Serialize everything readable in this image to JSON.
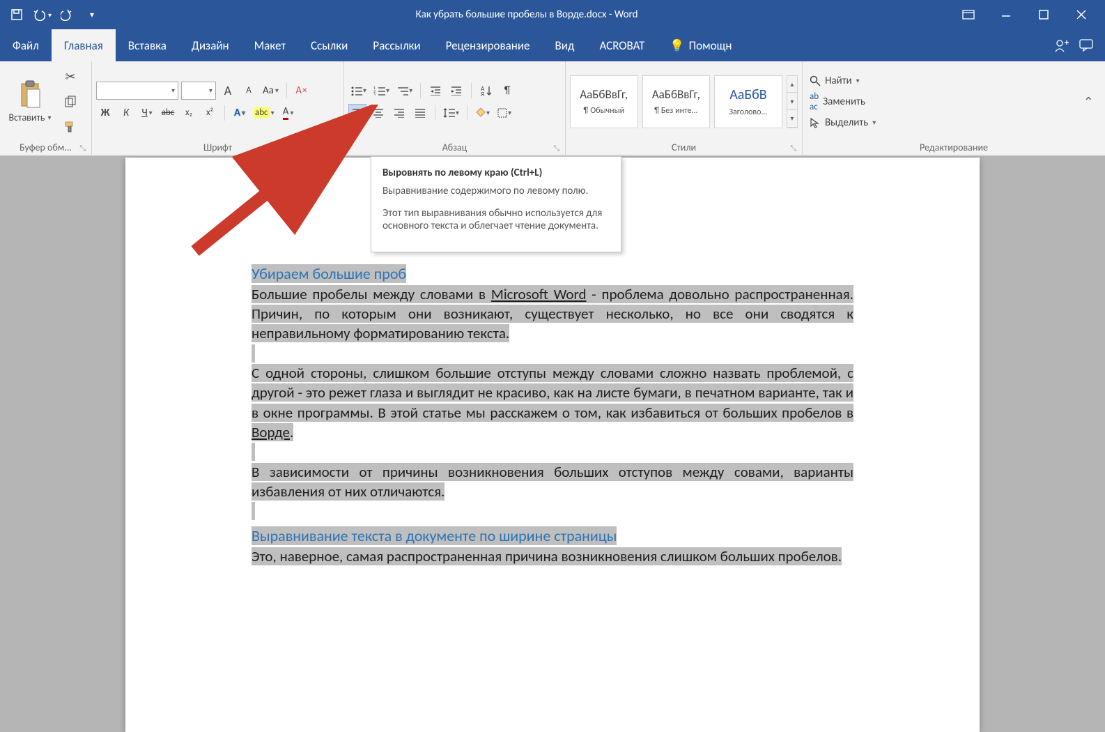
{
  "titlebar": {
    "doc_title": "Как убрать большие пробелы в Ворде.docx - Word"
  },
  "tabs": {
    "file": "Файл",
    "home": "Главная",
    "insert": "Вставка",
    "design": "Дизайн",
    "layout": "Макет",
    "references": "Ссылки",
    "mailings": "Рассылки",
    "review": "Рецензирование",
    "view": "Вид",
    "acrobat": "ACROBAT",
    "tell_me": "Помощн"
  },
  "ribbon": {
    "clipboard": {
      "paste": "Вставить",
      "group": "Буфер обм..."
    },
    "font": {
      "group": "Шрифт",
      "grow": "A",
      "shrink": "A",
      "case": "Aa",
      "bold": "Ж",
      "italic": "К",
      "underline": "Ч",
      "strike": "abc",
      "sub": "x₂",
      "sup": "x²",
      "effects": "A",
      "highlight": "abc",
      "color": "A"
    },
    "paragraph": {
      "group": "Абзац"
    },
    "styles": {
      "group": "Стили",
      "items": [
        {
          "sample": "АаБбВвГг,",
          "name": "¶ Обычный"
        },
        {
          "sample": "АаБбВвГг,",
          "name": "¶ Без инте..."
        },
        {
          "sample": "АаБбВ",
          "name": "Заголово..."
        }
      ]
    },
    "editing": {
      "group": "Редактирование",
      "find": "Найти",
      "replace": "Заменить",
      "select": "Выделить"
    }
  },
  "tooltip": {
    "title": "Выровнять по левому краю (Ctrl+L)",
    "p1": "Выравнивание содержимого по левому полю.",
    "p2": "Этот тип выравнивания обычно используется для основного текста и облегчает чтение документа."
  },
  "document": {
    "h1": "Убираем большие проб",
    "p1a": "Большие пробелы между словами в ",
    "p1_link": "Microsoft Word",
    "p1b": " - проблема довольно распространенная. Причин, по которым они возникают, существует несколько, но все они сводятся к неправильному форматированию текста.",
    "p2a": "С одной стороны, слишком большие отступы между словами сложно назвать проблемой, с другой - это режет глаза и выглядит не красиво, как на листе бумаги, в печатном варианте, так и в окне программы. В этой статье мы расскажем о том, как избавиться от больших пробелов в ",
    "p2_link": "Ворде",
    "p2b": ".",
    "p3": "В зависимости от причины возникновения больших отступов между совами, варианты избавления от них отличаются.",
    "h2": "Выравнивание текста в документе по ширине страницы",
    "p4": "Это, наверное, самая распространенная причина возникновения слишком больших пробелов."
  }
}
